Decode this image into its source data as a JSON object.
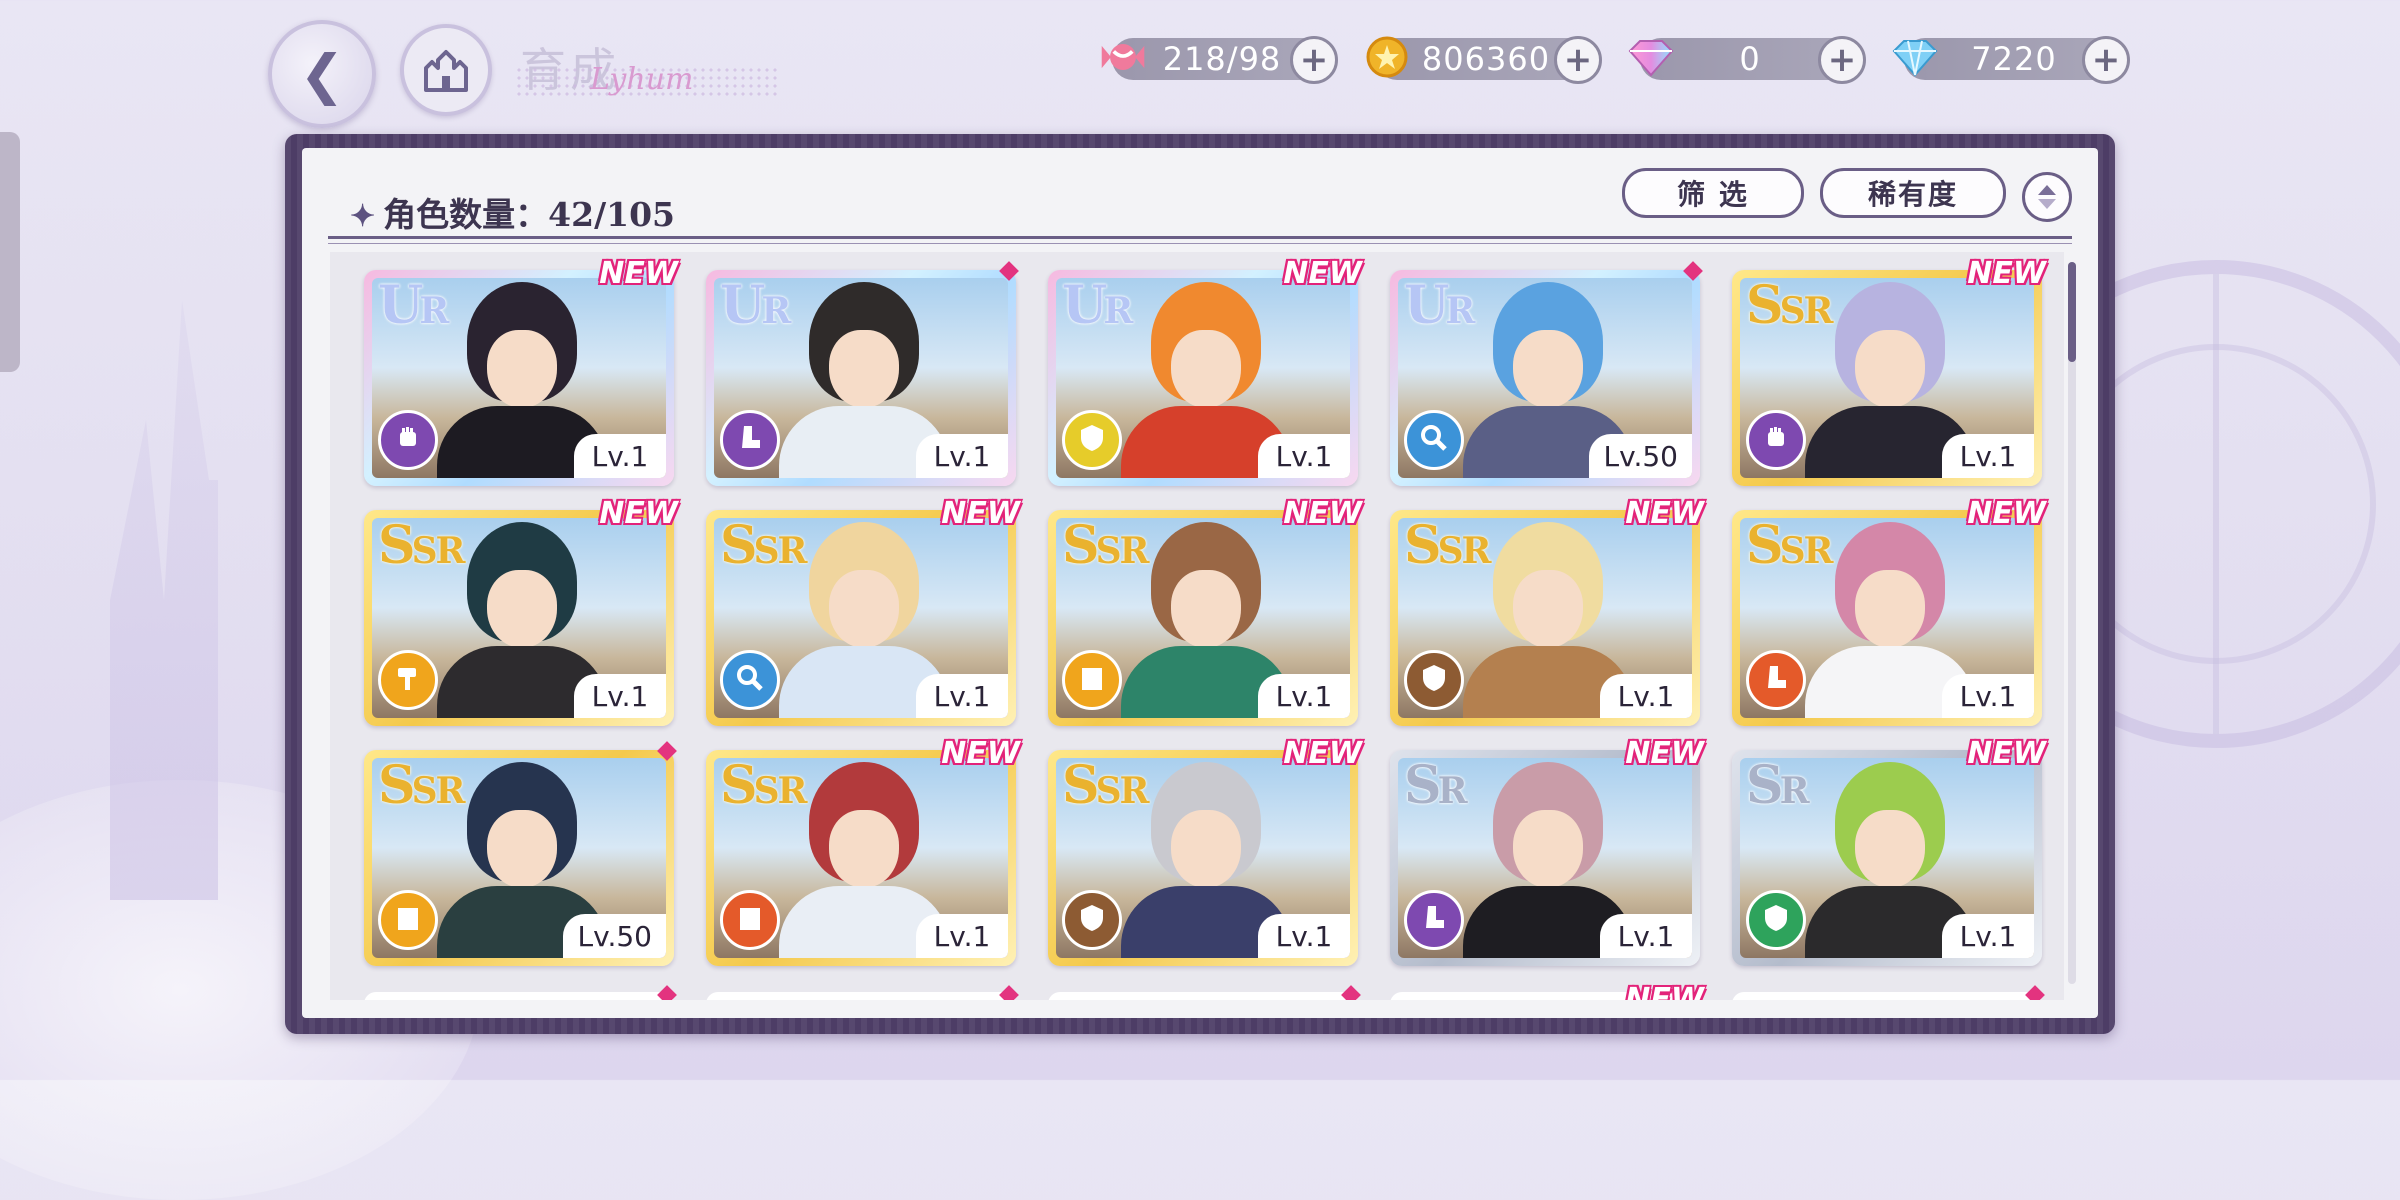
{
  "header": {
    "back_icon": "chevron-left-icon",
    "home_icon": "castle-icon",
    "title": "育成",
    "title_script": "Lyhum"
  },
  "resources": [
    {
      "name": "stamina",
      "icon": "candy-icon",
      "value": "218/98",
      "color": "#f07a9c"
    },
    {
      "name": "gold",
      "icon": "coin-icon",
      "value": "806360",
      "color": "#f0b429"
    },
    {
      "name": "paid-gems",
      "icon": "rainbow-diamond-icon",
      "value": "0",
      "color": "#e48ce0"
    },
    {
      "name": "free-gems",
      "icon": "diamond-icon",
      "value": "7220",
      "color": "#7fd0f6"
    }
  ],
  "panel": {
    "count_label": "角色数量",
    "count_value": "42/105",
    "filter_label": "筛 选",
    "sort_label": "稀有度"
  },
  "cards": [
    {
      "rarity": "UR",
      "level": "Lv.1",
      "new": true,
      "attr_color": "#7e49b0",
      "attr_icon": "fist-icon",
      "hair": "#2a2330",
      "outfit": "#1d1b22"
    },
    {
      "rarity": "UR",
      "level": "Lv.1",
      "new": false,
      "attr_color": "#7e49b0",
      "attr_icon": "boot-icon",
      "hair": "#2f2b2a",
      "outfit": "#e8eef4"
    },
    {
      "rarity": "UR",
      "level": "Lv.1",
      "new": true,
      "attr_color": "#e6cc2a",
      "attr_icon": "shield-icon",
      "hair": "#f0892f",
      "outfit": "#d6402b"
    },
    {
      "rarity": "UR",
      "level": "Lv.50",
      "new": false,
      "attr_color": "#3c93d8",
      "attr_icon": "magnifier-icon",
      "hair": "#5aa2e0",
      "outfit": "#5a5f86"
    },
    {
      "rarity": "SSR",
      "level": "Lv.1",
      "new": true,
      "attr_color": "#7e49b0",
      "attr_icon": "fist-icon",
      "hair": "#b7b3e0",
      "outfit": "#272530"
    },
    {
      "rarity": "SSR",
      "level": "Lv.1",
      "new": true,
      "attr_color": "#f0a51c",
      "attr_icon": "hammer-icon",
      "hair": "#1f3b44",
      "outfit": "#2d2b2e"
    },
    {
      "rarity": "SSR",
      "level": "Lv.1",
      "new": true,
      "attr_color": "#3c93d8",
      "attr_icon": "magnifier-icon",
      "hair": "#f0d59e",
      "outfit": "#d9e6f5"
    },
    {
      "rarity": "SSR",
      "level": "Lv.1",
      "new": true,
      "attr_color": "#f0a51c",
      "attr_icon": "book-icon",
      "hair": "#9a6745",
      "outfit": "#2d8469"
    },
    {
      "rarity": "SSR",
      "level": "Lv.1",
      "new": true,
      "attr_color": "#8d5b33",
      "attr_icon": "shield-icon",
      "hair": "#f0dca0",
      "outfit": "#b4804f"
    },
    {
      "rarity": "SSR",
      "level": "Lv.1",
      "new": true,
      "attr_color": "#e45a2a",
      "attr_icon": "boot-icon",
      "hair": "#d487a8",
      "outfit": "#f5f5f7"
    },
    {
      "rarity": "SSR",
      "level": "Lv.50",
      "new": false,
      "attr_color": "#f0a51c",
      "attr_icon": "book-icon",
      "hair": "#26344f",
      "outfit": "#2a3f40"
    },
    {
      "rarity": "SSR",
      "level": "Lv.1",
      "new": true,
      "attr_color": "#e45a2a",
      "attr_icon": "book-icon",
      "hair": "#b23a3c",
      "outfit": "#e9eef5"
    },
    {
      "rarity": "SSR",
      "level": "Lv.1",
      "new": true,
      "attr_color": "#8d5b33",
      "attr_icon": "shield-icon",
      "hair": "#c9c9cf",
      "outfit": "#3a3f6a"
    },
    {
      "rarity": "SR",
      "level": "Lv.1",
      "new": true,
      "attr_color": "#7e49b0",
      "attr_icon": "boot-icon",
      "hair": "#c99ca8",
      "outfit": "#1e1d22"
    },
    {
      "rarity": "SR",
      "level": "Lv.1",
      "new": true,
      "attr_color": "#2ea35c",
      "attr_icon": "shield-icon",
      "hair": "#9ccc4e",
      "outfit": "#2b2a2c"
    }
  ],
  "next_row_badges": [
    "dot",
    "dot",
    "dot",
    "NEW",
    "dot"
  ],
  "new_badge_text": "NEW"
}
